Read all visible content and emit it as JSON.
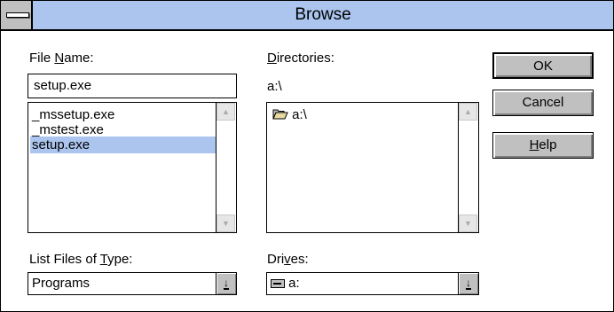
{
  "window": {
    "title": "Browse"
  },
  "file_name": {
    "label_pre": "File ",
    "label_accel": "N",
    "label_post": "ame:",
    "value": "setup.exe"
  },
  "files": [
    {
      "name": "_mssetup.exe",
      "selected": false
    },
    {
      "name": "_mstest.exe",
      "selected": false
    },
    {
      "name": "setup.exe",
      "selected": true
    }
  ],
  "directories": {
    "label_accel": "D",
    "label_post": "irectories:",
    "current_path": "a:\\",
    "items": [
      {
        "name": "a:\\"
      }
    ]
  },
  "file_type": {
    "label_pre": "List Files of ",
    "label_accel": "T",
    "label_post": "ype:",
    "value": "Programs"
  },
  "drives": {
    "label_pre": "Dri",
    "label_accel": "v",
    "label_post": "es:",
    "value": "a:"
  },
  "buttons": {
    "ok": "OK",
    "cancel": "Cancel",
    "help_accel": "H",
    "help_post": "elp"
  },
  "colors": {
    "title_bar": "#abc5ee",
    "selection": "#abc5ee",
    "button_face": "#c0c0c0"
  },
  "icons": {
    "system_menu": "system-menu-icon",
    "folder": "open-folder-icon",
    "drive": "floppy-drive-icon"
  }
}
